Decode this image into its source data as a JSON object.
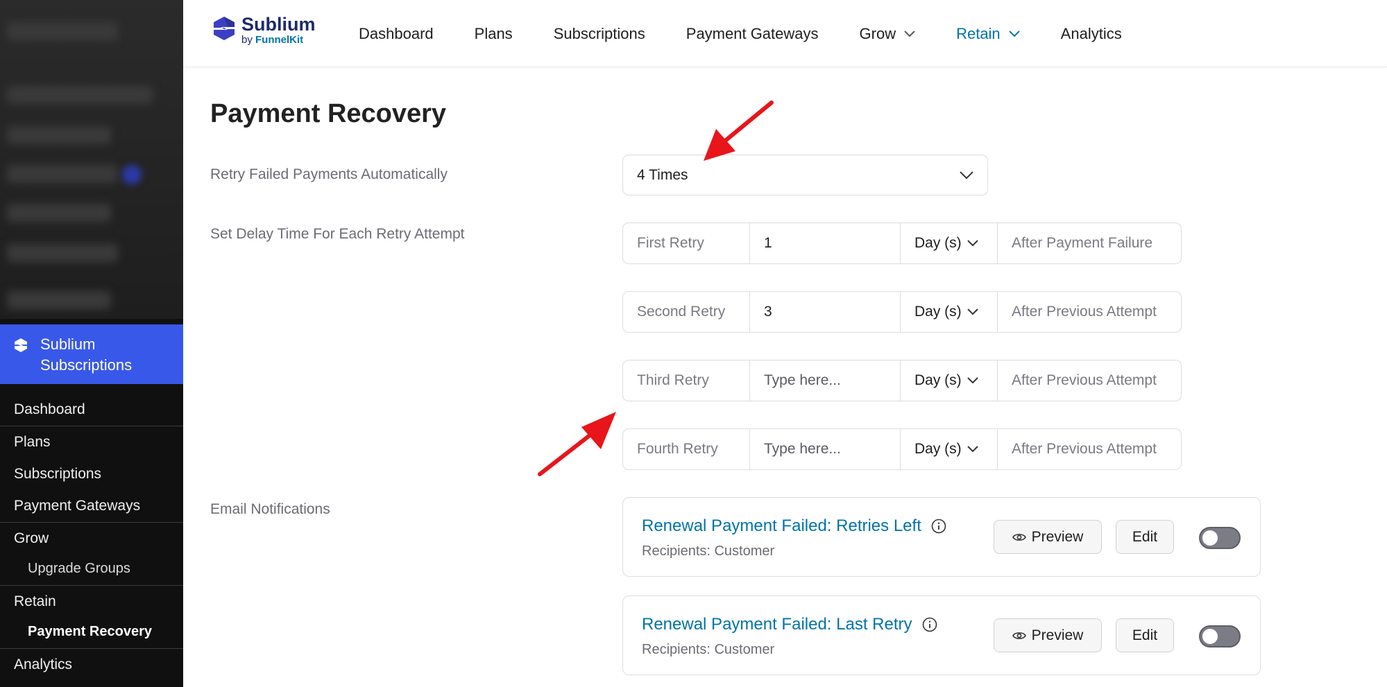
{
  "sidebar": {
    "brand": {
      "line1": "Sublium",
      "line2": "Subscriptions"
    },
    "items": [
      {
        "label": "Dashboard"
      },
      {
        "label": "Plans"
      },
      {
        "label": "Subscriptions"
      },
      {
        "label": "Payment Gateways"
      },
      {
        "label": "Grow"
      },
      {
        "label": "Upgrade Groups"
      },
      {
        "label": "Retain"
      },
      {
        "label": "Payment Recovery"
      },
      {
        "label": "Analytics"
      }
    ]
  },
  "header": {
    "logo": {
      "title": "Sublium",
      "by": "by",
      "company": "FunnelKit"
    },
    "nav": [
      {
        "label": "Dashboard"
      },
      {
        "label": "Plans"
      },
      {
        "label": "Subscriptions"
      },
      {
        "label": "Payment Gateways"
      },
      {
        "label": "Grow"
      },
      {
        "label": "Retain"
      },
      {
        "label": "Analytics"
      }
    ]
  },
  "main": {
    "title": "Payment Recovery",
    "retry_automatic": {
      "label": "Retry Failed Payments Automatically",
      "value": "4 Times"
    },
    "delay": {
      "label": "Set Delay Time For Each Retry Attempt",
      "rows": [
        {
          "name": "First Retry",
          "value": "1",
          "placeholder": "",
          "unit": "Day (s)",
          "after": "After Payment Failure"
        },
        {
          "name": "Second Retry",
          "value": "3",
          "placeholder": "",
          "unit": "Day (s)",
          "after": "After Previous Attempt"
        },
        {
          "name": "Third Retry",
          "value": "",
          "placeholder": "Type here...",
          "unit": "Day (s)",
          "after": "After Previous Attempt"
        },
        {
          "name": "Fourth Retry",
          "value": "",
          "placeholder": "Type here...",
          "unit": "Day (s)",
          "after": "After Previous Attempt"
        }
      ]
    },
    "email": {
      "label": "Email Notifications",
      "cards": [
        {
          "title": "Renewal Payment Failed: Retries Left",
          "recipients": "Recipients: Customer",
          "preview": "Preview",
          "edit": "Edit",
          "enabled": false
        },
        {
          "title": "Renewal Payment Failed: Last Retry",
          "recipients": "Recipients: Customer",
          "preview": "Preview",
          "edit": "Edit",
          "enabled": false
        }
      ]
    }
  },
  "colors": {
    "accent": "#0073aa",
    "sidebar_active": "#3858e9",
    "arrow": "#e8151b"
  }
}
